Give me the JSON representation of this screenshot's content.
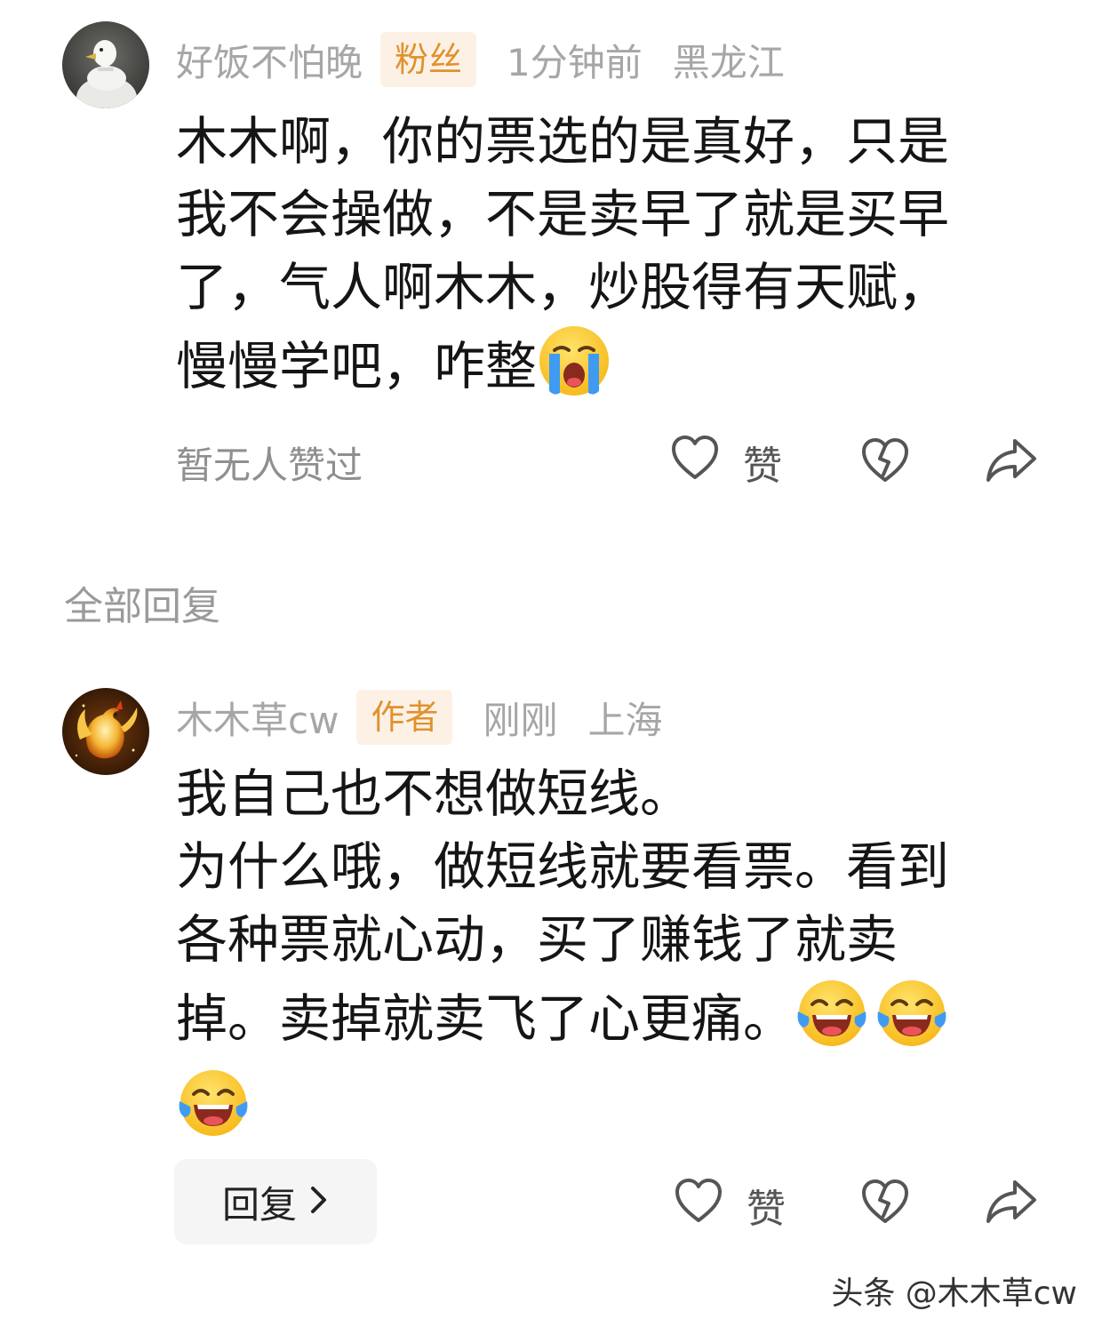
{
  "comment": {
    "username": "好饭不怕晚",
    "badge": "粉丝",
    "time": "1分钟前",
    "location": "黑龙江",
    "text_lines": [
      "木木啊，你的票选的是真好，只是",
      "我不会操做，不是卖早了就是买早",
      "了，气人啊木木，炒股得有天赋，",
      "慢慢学吧，咋整"
    ],
    "emojis": [
      "crying-face-emoji"
    ],
    "like_status": "暂无人赞过",
    "like_label": "赞",
    "icons": [
      "heart-icon",
      "broken-heart-icon",
      "share-icon"
    ]
  },
  "replies_section": {
    "title": "全部回复"
  },
  "reply": {
    "username": "木木草cw",
    "badge": "作者",
    "time": "刚刚",
    "location": "上海",
    "text_lines": [
      "我自己也不想做短线。",
      "为什么哦，做短线就要看票。看到",
      "各种票就心动，买了赚钱了就卖",
      "掉。卖掉就卖飞了心更痛。"
    ],
    "emojis": [
      "laughing-tears-emoji",
      "laughing-tears-emoji",
      "laughing-tears-emoji"
    ],
    "reply_button_label": "回复",
    "like_label": "赞",
    "icons": [
      "heart-icon",
      "broken-heart-icon",
      "share-icon",
      "chevron-right-icon"
    ]
  },
  "watermark": "头条 @木木草cw",
  "colors": {
    "badge_bg": "#fdf1e6",
    "badge_text": "#e0922e",
    "meta_text": "#a6a6a6",
    "body_text": "#151515"
  }
}
